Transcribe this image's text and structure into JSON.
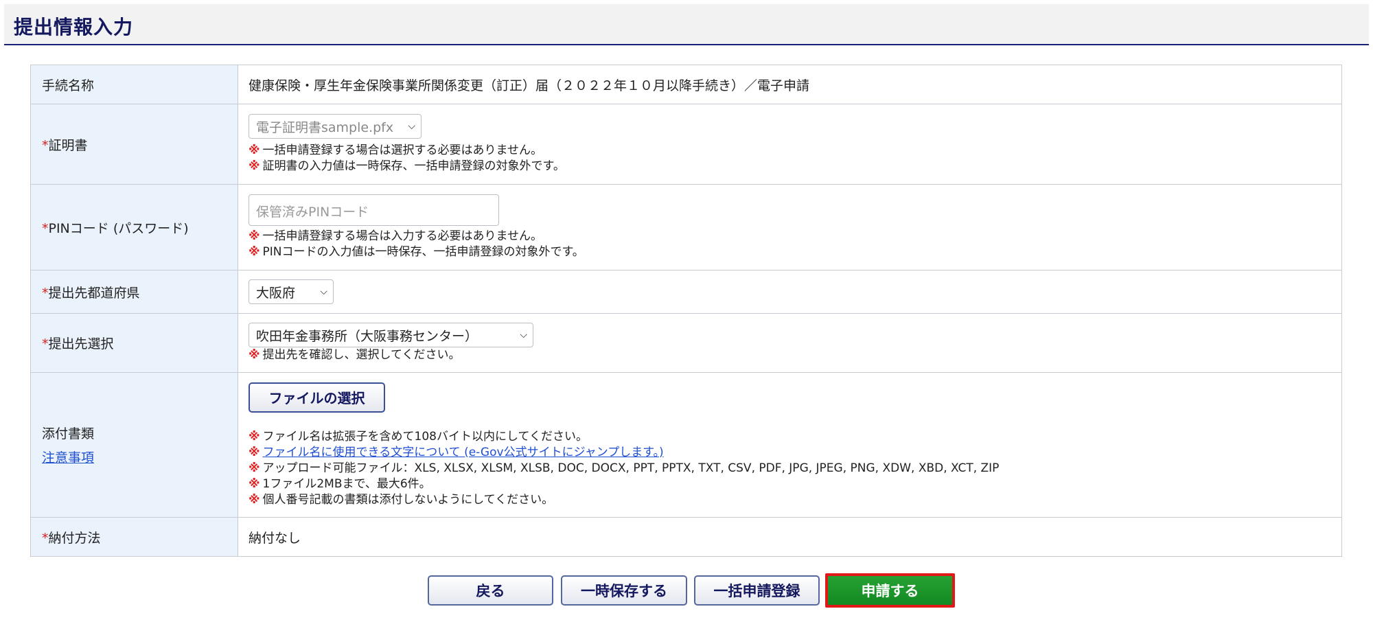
{
  "header": {
    "title": "提出情報入力"
  },
  "form": {
    "procedure": {
      "label": "手続名称",
      "value": "健康保険・厚生年金保険事業所関係変更（訂正）届（２０２２年１０月以降手続き）／電子申請"
    },
    "certificate": {
      "required_mark": "*",
      "label": "証明書",
      "selected": "電子証明書sample.pfx",
      "notes": [
        "一括申請登録する場合は選択する必要はありません。",
        "証明書の入力値は一時保存、一括申請登録の対象外です。"
      ]
    },
    "pin": {
      "required_mark": "*",
      "label": "PINコード (パスワード)",
      "placeholder": "保管済みPINコード",
      "notes": [
        "一括申請登録する場合は入力する必要はありません。",
        "PINコードの入力値は一時保存、一括申請登録の対象外です。"
      ]
    },
    "prefecture": {
      "required_mark": "*",
      "label": "提出先都道府県",
      "selected": "大阪府"
    },
    "destination": {
      "required_mark": "*",
      "label": "提出先選択",
      "selected": "吹田年金事務所（大阪事務センター）",
      "notes": [
        "提出先を確認し、選択してください。"
      ]
    },
    "attachments": {
      "label": "添付書類",
      "link_label": "注意事項",
      "file_button": "ファイルの選択",
      "notes": [
        "ファイル名は拡張子を含めて108バイト以内にしてください。",
        "ファイル名に使用できる文字について (e-Gov公式サイトにジャンプします。)",
        "アップロード可能ファイル：XLS, XLSX, XLSM, XLSB, DOC, DOCX, PPT, PPTX, TXT, CSV, PDF, JPG, JPEG, PNG, XDW, XBD, XCT, ZIP",
        "1ファイル2MBまで、最大6件。",
        "個人番号記載の書類は添付しないようにしてください。"
      ]
    },
    "payment": {
      "required_mark": "*",
      "label": "納付方法",
      "value": "納付なし"
    },
    "note_mark": "※"
  },
  "buttons": {
    "back": "戻る",
    "save": "一時保存する",
    "batch": "一括申請登録",
    "submit": "申請する"
  },
  "colors": {
    "header_border": "#1a1f7a",
    "label_bg": "#eaf2fb",
    "required": "#d62020",
    "submit_bg": "#1b9428",
    "submit_border": "#e01818",
    "link": "#1f4fd1"
  }
}
